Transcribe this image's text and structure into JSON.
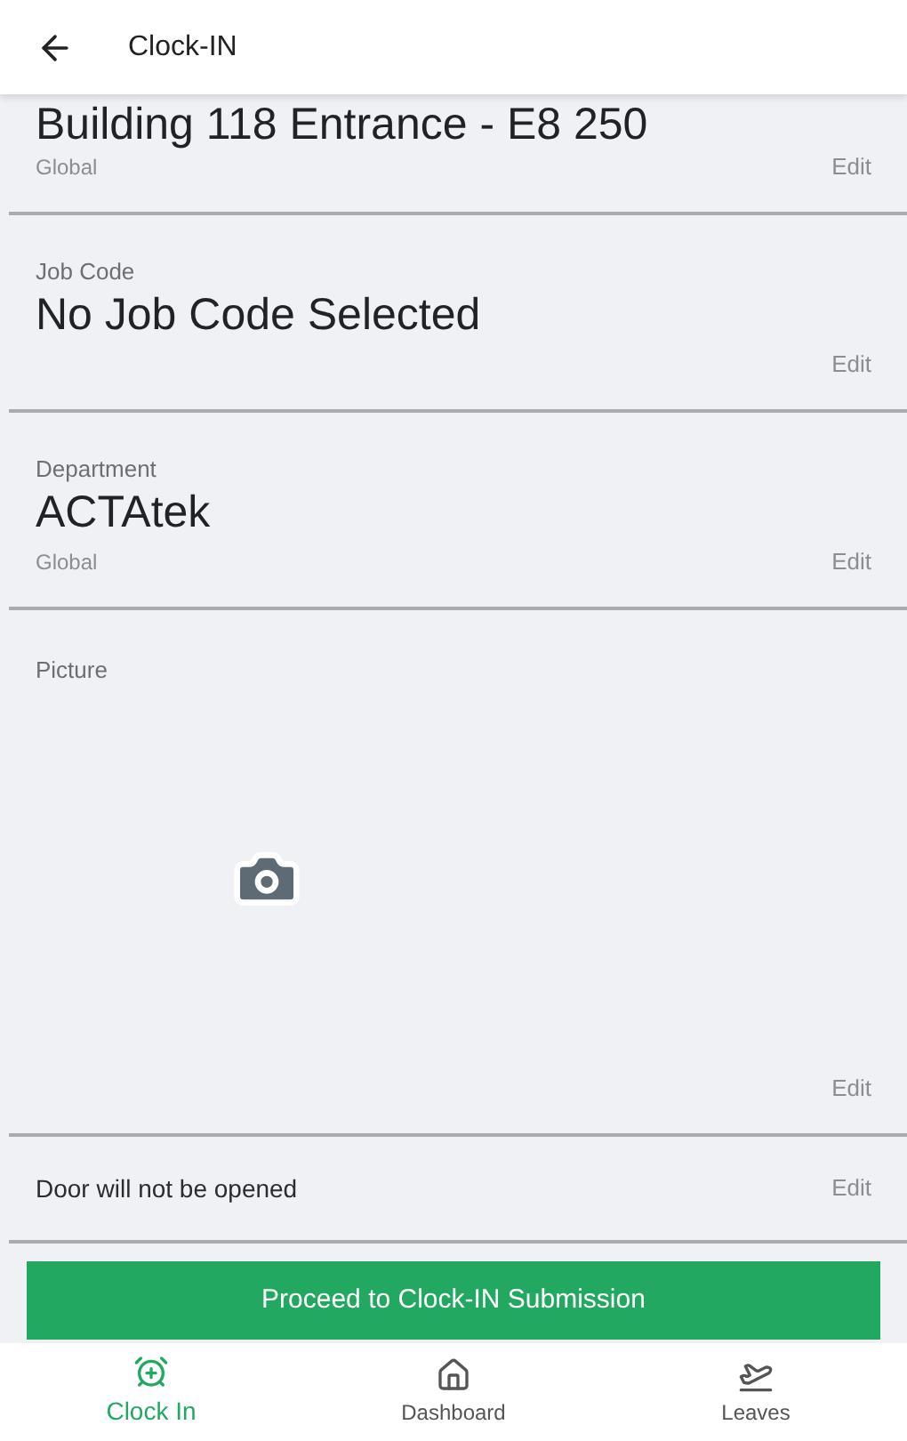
{
  "header": {
    "title": "Clock-IN"
  },
  "sections": [
    {
      "kind": "field",
      "value": "Building 118 Entrance - E8 250",
      "scope": "Global",
      "action": "Edit"
    },
    {
      "kind": "field",
      "label": "Job Code",
      "value": "No Job Code Selected",
      "action": "Edit"
    },
    {
      "kind": "field",
      "label": "Department",
      "value": "ACTAtek",
      "scope": "Global",
      "action": "Edit"
    },
    {
      "kind": "picture",
      "label": "Picture",
      "action": "Edit"
    },
    {
      "kind": "note",
      "value": "Door will not be opened",
      "action": "Edit"
    }
  ],
  "submit_button": "Proceed to Clock-IN Submission",
  "nav": [
    {
      "kind": "clock",
      "label": "Clock In",
      "selected": true
    },
    {
      "kind": "home",
      "label": "Dashboard",
      "selected": false
    },
    {
      "kind": "plane",
      "label": "Leaves",
      "selected": false
    }
  ]
}
